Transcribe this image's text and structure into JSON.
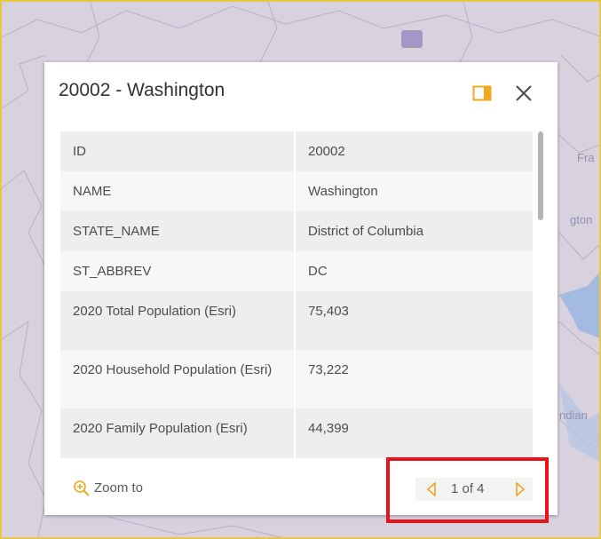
{
  "map": {
    "labels": [
      "Fra",
      "gton",
      "ndian"
    ]
  },
  "popup": {
    "title": "20002 - Washington",
    "dock_icon": "dock-panel-icon",
    "close_icon": "close-icon",
    "fields": [
      {
        "key": "ID",
        "value": "20002"
      },
      {
        "key": "NAME",
        "value": "Washington"
      },
      {
        "key": "STATE_NAME",
        "value": "District of Columbia"
      },
      {
        "key": "ST_ABBREV",
        "value": "DC"
      },
      {
        "key": "2020 Total Population (Esri)",
        "value": "75,403"
      },
      {
        "key": "2020 Household Population (Esri)",
        "value": "73,222"
      },
      {
        "key": "2020 Family Population (Esri)",
        "value": "44,399"
      }
    ],
    "footer": {
      "zoom_label": "Zoom to",
      "zoom_icon": "zoom-in-icon",
      "pager_text": "1 of 4",
      "prev_icon": "previous-icon",
      "next_icon": "next-icon"
    }
  },
  "colors": {
    "accent": "#f0a81e",
    "highlight_border": "#e8111c",
    "map_border": "#e8c840"
  }
}
